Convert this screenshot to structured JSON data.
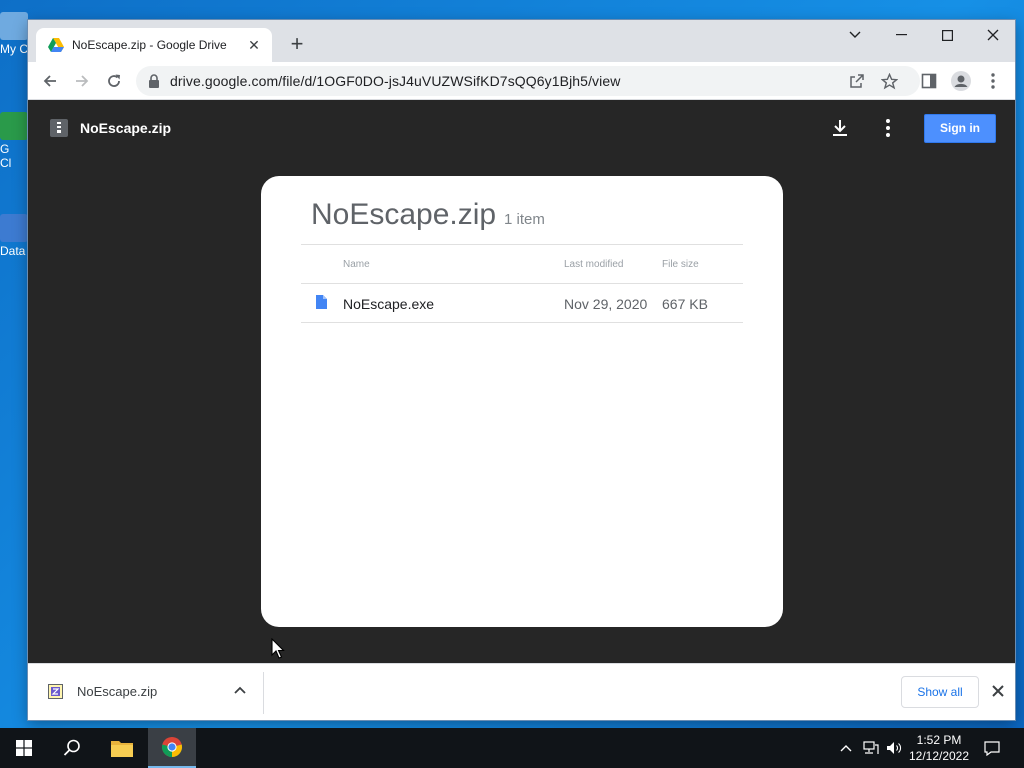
{
  "desktop": {
    "icons": [
      {
        "label": "My C"
      },
      {
        "label": "G\nCl"
      },
      {
        "label": "Data"
      }
    ]
  },
  "browser": {
    "tab": {
      "title": "NoEscape.zip - Google Drive"
    },
    "address": {
      "url": "drive.google.com/file/d/1OGF0DO-jsJ4uVUZWSifKD7sQQ6y1Bjh5/view"
    }
  },
  "viewer": {
    "file_name": "NoEscape.zip",
    "sign_in_label": "Sign in",
    "card": {
      "title": "NoEscape.zip",
      "count": "1 item",
      "columns": {
        "name": "Name",
        "modified": "Last modified",
        "size": "File size"
      },
      "rows": [
        {
          "name": "NoEscape.exe",
          "modified": "Nov 29, 2020",
          "size": "667 KB"
        }
      ]
    }
  },
  "downloads": {
    "item_name": "NoEscape.zip",
    "show_all_label": "Show all"
  },
  "taskbar": {
    "time": "1:52 PM",
    "date": "12/12/2022"
  },
  "colors": {
    "viewer_bg": "#262626",
    "sign_in": "#4d90fe",
    "link": "#1a73e8",
    "desktop": "#0e6fc7"
  }
}
